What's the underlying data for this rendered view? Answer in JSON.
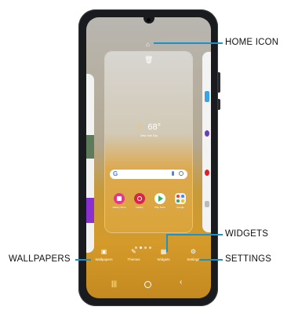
{
  "callouts": {
    "home_icon": "HOME ICON",
    "widgets": "WIDGETS",
    "wallpapers": "WALLPAPERS",
    "settings": "SETTINGS"
  },
  "weather": {
    "temp": "68°",
    "city": "New York City"
  },
  "search": {
    "logo": "G"
  },
  "apps": [
    {
      "label": "Galaxy Store",
      "color": "#e8358f",
      "icon": "bag-icon"
    },
    {
      "label": "Gallery",
      "color": "#d9234a",
      "icon": "flower-icon"
    },
    {
      "label": "Play Store",
      "color": "#ffffff",
      "icon": "play-icon"
    },
    {
      "label": "Google",
      "color": "#f2f2f2",
      "icon": "google-folder-icon"
    }
  ],
  "dock": {
    "wallpapers": "Wallpapers",
    "themes": "Themes",
    "widgets": "Widgets",
    "settings": "Settings"
  },
  "page_indicator": {
    "count": 4,
    "active": 2
  },
  "colors": {
    "callout_line": "#1a93c8",
    "phone": "#1a1b1f"
  }
}
